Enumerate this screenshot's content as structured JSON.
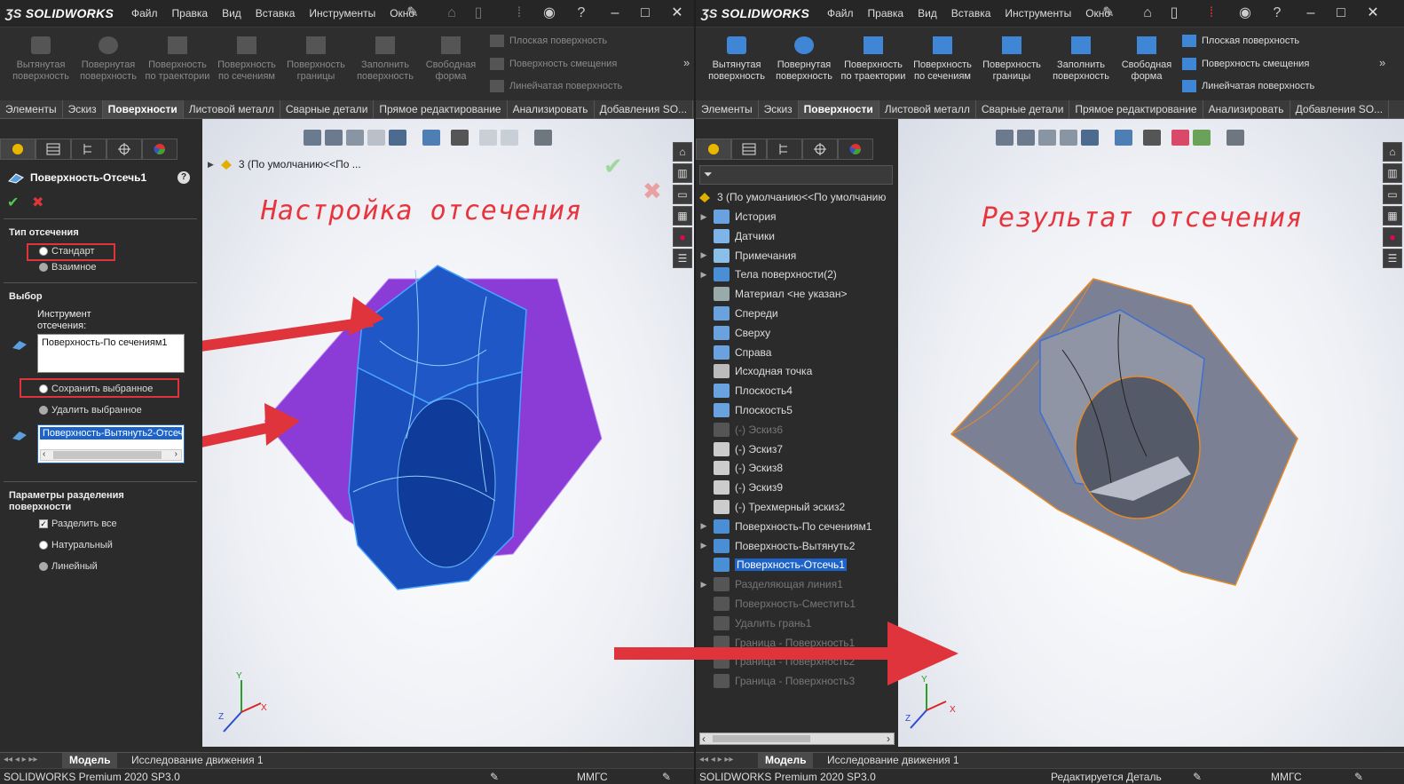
{
  "app_name": "SOLIDWORKS",
  "menus": [
    "Файл",
    "Правка",
    "Вид",
    "Вставка",
    "Инструменты",
    "Окно"
  ],
  "ribbon": {
    "big": [
      "Вытянутая поверхность",
      "Повернутая поверхность",
      "Поверхность по траектории",
      "Поверхность по сечениям",
      "Поверхность границы",
      "Заполнить поверхность",
      "Свободная форма"
    ],
    "small": [
      "Плоская поверхность",
      "Поверхность смещения",
      "Линейчатая поверхность"
    ]
  },
  "tabs": [
    "Элементы",
    "Эскиз",
    "Поверхности",
    "Листовой металл",
    "Сварные детали",
    "Прямое редактирование",
    "Анализировать",
    "Добавления SO..."
  ],
  "active_tab": "Поверхности",
  "left": {
    "feature_title": "Поверхность-Отсечь1",
    "trim_type_label": "Тип отсечения",
    "trim_standard": "Стандарт",
    "trim_mutual": "Взаимное",
    "selection_label": "Выбор",
    "tool_label": "Инструмент отсечения:",
    "tool_value": "Поверхность-По сечениям1",
    "keep_selected": "Сохранить выбранное",
    "remove_selected": "Удалить выбранное",
    "selected_body": "Поверхность-Вытянуть2-Отсеч",
    "split_params_label": "Параметры разделения поверхности",
    "split_all": "Разделить все",
    "natural": "Натуральный",
    "linear": "Линейный",
    "tree_root": "3  (По умолчанию<<По ...",
    "overlay_text": "Настройка отсечения"
  },
  "right": {
    "tree_root": "3  (По умолчанию<<По умолчанию",
    "tree": [
      {
        "label": "История",
        "expand": true,
        "dim": false
      },
      {
        "label": "Датчики",
        "expand": false,
        "dim": false
      },
      {
        "label": "Примечания",
        "expand": true,
        "dim": false
      },
      {
        "label": "Тела поверхности(2)",
        "expand": true,
        "dim": false
      },
      {
        "label": "Материал <не указан>",
        "expand": false,
        "dim": false
      },
      {
        "label": "Спереди",
        "expand": false,
        "dim": false
      },
      {
        "label": "Сверху",
        "expand": false,
        "dim": false
      },
      {
        "label": "Справа",
        "expand": false,
        "dim": false
      },
      {
        "label": "Исходная точка",
        "expand": false,
        "dim": false
      },
      {
        "label": "Плоскость4",
        "expand": false,
        "dim": false
      },
      {
        "label": "Плоскость5",
        "expand": false,
        "dim": false
      },
      {
        "label": "(-) Эскиз6",
        "expand": false,
        "dim": true
      },
      {
        "label": "(-) Эскиз7",
        "expand": false,
        "dim": false
      },
      {
        "label": "(-) Эскиз8",
        "expand": false,
        "dim": false
      },
      {
        "label": "(-) Эскиз9",
        "expand": false,
        "dim": false
      },
      {
        "label": "(-) Трехмерный эскиз2",
        "expand": false,
        "dim": false
      },
      {
        "label": "Поверхность-По сечениям1",
        "expand": true,
        "dim": false
      },
      {
        "label": "Поверхность-Вытянуть2",
        "expand": true,
        "dim": false
      },
      {
        "label": "Поверхность-Отсечь1",
        "expand": false,
        "dim": false,
        "selected": true
      },
      {
        "label": "Разделяющая линия1",
        "expand": true,
        "dim": true
      },
      {
        "label": "Поверхность-Сместить1",
        "expand": false,
        "dim": true
      },
      {
        "label": "Удалить грань1",
        "expand": false,
        "dim": true
      },
      {
        "label": "Граница - Поверхность1",
        "expand": false,
        "dim": true
      },
      {
        "label": "Граница - Поверхность2",
        "expand": false,
        "dim": true
      },
      {
        "label": "Граница - Поверхность3",
        "expand": false,
        "dim": true
      }
    ],
    "overlay_text": "Результат отсечения",
    "status_edit": "Редактируется Деталь"
  },
  "bottom_tabs": [
    "Модель",
    "Исследование движения 1"
  ],
  "status_version": "SOLIDWORKS Premium 2020 SP3.0",
  "status_units": "ММГС",
  "axis": {
    "x": "X",
    "y": "Y",
    "z": "Z"
  }
}
